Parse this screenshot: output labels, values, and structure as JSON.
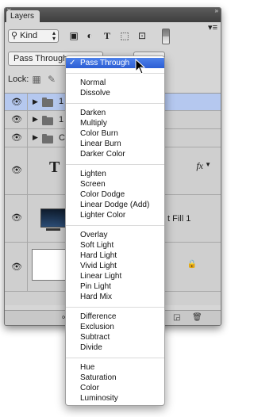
{
  "panel": {
    "tab_label": "Layers",
    "menu_icon": "panel-menu-icon"
  },
  "filter": {
    "kind_label": "Kind",
    "icons": [
      "image-filter-icon",
      "adjustment-filter-icon",
      "type-filter-icon",
      "shape-filter-icon",
      "smart-object-filter-icon"
    ]
  },
  "blend": {
    "current": "Pass Through"
  },
  "lock": {
    "label": "Lock:"
  },
  "layers": [
    {
      "kind": "group",
      "name": "1",
      "selected": true
    },
    {
      "kind": "group",
      "name": "1",
      "selected": false
    },
    {
      "kind": "group",
      "name": "C",
      "selected": false
    },
    {
      "kind": "type",
      "name": "",
      "fx": "fx"
    },
    {
      "kind": "fill",
      "name": "t Fill 1"
    },
    {
      "kind": "background",
      "name": ""
    }
  ],
  "menu": {
    "groups": [
      [
        "Pass Through"
      ],
      [
        "Normal",
        "Dissolve"
      ],
      [
        "Darken",
        "Multiply",
        "Color Burn",
        "Linear Burn",
        "Darker Color"
      ],
      [
        "Lighten",
        "Screen",
        "Color Dodge",
        "Linear Dodge (Add)",
        "Lighter Color"
      ],
      [
        "Overlay",
        "Soft Light",
        "Hard Light",
        "Vivid Light",
        "Linear Light",
        "Pin Light",
        "Hard Mix"
      ],
      [
        "Difference",
        "Exclusion",
        "Subtract",
        "Divide"
      ],
      [
        "Hue",
        "Saturation",
        "Color",
        "Luminosity"
      ]
    ],
    "selected": "Pass Through",
    "check_glyph": "✓"
  },
  "colors": {
    "highlight": "#3a6ee0",
    "selected_layer": "#b5c8ef"
  }
}
